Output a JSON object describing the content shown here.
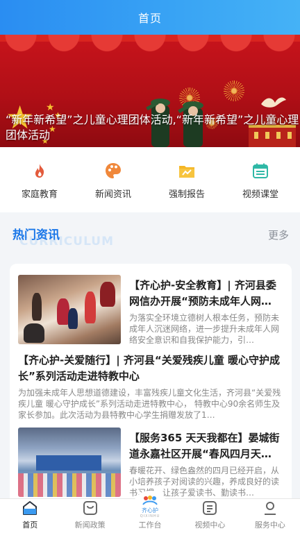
{
  "header": {
    "title": "首页"
  },
  "banner": {
    "caption": "“新年新希望”之儿童心理团体活动,“新年新希望”之儿童心理团体活动",
    "dots": 5,
    "active_dot": 0
  },
  "quick_nav": [
    {
      "label": "家庭教育",
      "icon": "flame-icon",
      "color": "#e35b3c"
    },
    {
      "label": "新闻资讯",
      "icon": "palette-icon",
      "color": "#f0883b"
    },
    {
      "label": "强制报告",
      "icon": "report-folder-icon",
      "color": "#f5b625"
    },
    {
      "label": "视频课堂",
      "icon": "calendar-icon",
      "color": "#2fb8a6"
    }
  ],
  "hot_news": {
    "title": "热门资讯",
    "ghost": "CURRICULUM",
    "more": "更多"
  },
  "news": [
    {
      "title": "【齐心护-安全教育】| 齐河县委网信办开展“预防未成年人网…",
      "desc": "为落实全环境立德树人根本任务，预防未成年人沉迷网络，进一步提升未成年人网络安全意识和自我保护能力，引…"
    },
    {
      "title": "【齐心护-关爱随行】| 齐河县“关爱残疾儿童 暖心守护成长”系列活动走进特教中心",
      "desc": "为加强未成年人思想道德建设，丰富残疾儿童文化生活，齐河县“关爱残疾儿童 暖心守护成长”系列活动走进特教中心， 特教中心90余名师生及家长参加。此次活动为县特教中心学生捐赠发放了1…"
    },
    {
      "title": "【服务365 天天我都在】晏城街道永嘉社区开展“春风四月天…",
      "desc": "春暖花开、绿色盎然的四月已经开启，从小培养孩子对阅读的兴趣，养成良好的读书习惯，让孩子爱读书、勤读书…"
    }
  ],
  "tabbar": {
    "items": [
      {
        "label": "首页",
        "icon": "home-icon",
        "active": true
      },
      {
        "label": "新闻政策",
        "icon": "bag-icon",
        "active": false
      },
      {
        "label": "工作台",
        "icon": "logo-icon",
        "active": false
      },
      {
        "label": "视频中心",
        "icon": "video-list-icon",
        "active": false
      },
      {
        "label": "服务中心",
        "icon": "user-icon",
        "active": false
      }
    ],
    "logo_text": "齐心护",
    "logo_sub": "QIXINHU"
  }
}
